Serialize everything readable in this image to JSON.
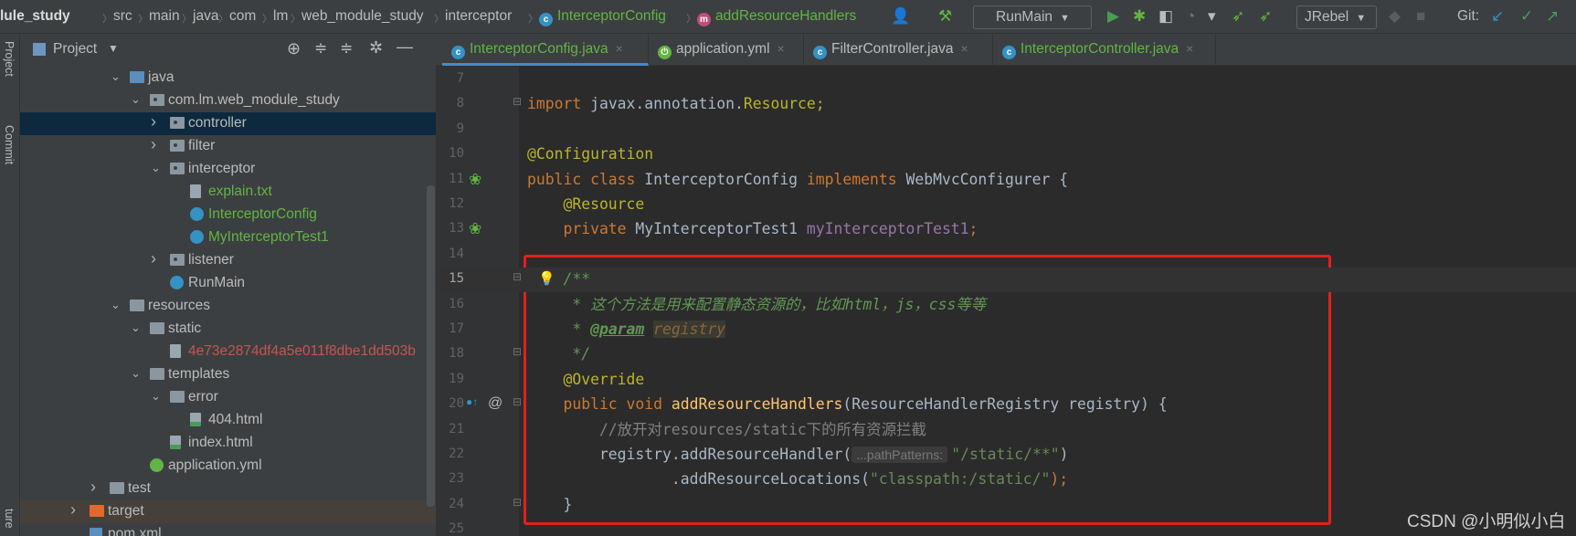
{
  "breadcrumb": [
    "lule_study",
    "src",
    "main",
    "java",
    "com",
    "lm",
    "web_module_study",
    "interceptor",
    "InterceptorConfig",
    "addResourceHandlers"
  ],
  "toolbar": {
    "run_config": "RunMain",
    "jrebel": "JRebel",
    "git_label": "Git:",
    "icons": [
      "user-icon",
      "build-hammer-icon",
      "run-icon",
      "debug-icon",
      "coverage-icon",
      "profile-icon",
      "jrebel-run-icon",
      "jrebel-debug-icon",
      "git-update-icon",
      "git-commit-icon",
      "git-push-icon"
    ]
  },
  "sidestrip": {
    "project": "Project",
    "commit": "Commit",
    "structure": "ture"
  },
  "project_panel": {
    "title": "Project"
  },
  "tree": [
    {
      "label": "java",
      "depth": 0,
      "arrow": "down",
      "icon": "folder-blue"
    },
    {
      "label": "com.lm.web_module_study",
      "depth": 1,
      "arrow": "down",
      "icon": "package"
    },
    {
      "label": "controller",
      "depth": 2,
      "arrow": "right",
      "icon": "package",
      "selected": true
    },
    {
      "label": "filter",
      "depth": 2,
      "arrow": "right",
      "icon": "package"
    },
    {
      "label": "interceptor",
      "depth": 2,
      "arrow": "down",
      "icon": "package"
    },
    {
      "label": "explain.txt",
      "depth": 3,
      "icon": "file",
      "color": "#62b543"
    },
    {
      "label": "InterceptorConfig",
      "depth": 3,
      "icon": "class",
      "color": "#62b543"
    },
    {
      "label": "MyInterceptorTest1",
      "depth": 3,
      "icon": "class",
      "color": "#62b543"
    },
    {
      "label": "listener",
      "depth": 2,
      "arrow": "right",
      "icon": "package"
    },
    {
      "label": "RunMain",
      "depth": 2,
      "icon": "class"
    },
    {
      "label": "resources",
      "depth": 0,
      "arrow": "down",
      "icon": "folder"
    },
    {
      "label": "static",
      "depth": 1,
      "arrow": "down",
      "icon": "folder"
    },
    {
      "label": "4e73e2874df4a5e011f8dbe1dd503b",
      "depth": 2,
      "icon": "file",
      "color": "#c75450"
    },
    {
      "label": "templates",
      "depth": 1,
      "arrow": "down",
      "icon": "folder"
    },
    {
      "label": "error",
      "depth": 2,
      "arrow": "down",
      "icon": "folder"
    },
    {
      "label": "404.html",
      "depth": 3,
      "icon": "html"
    },
    {
      "label": "index.html",
      "depth": 2,
      "icon": "html"
    },
    {
      "label": "application.yml",
      "depth": 1,
      "icon": "spring"
    },
    {
      "label": "test",
      "depth": -1,
      "arrow": "right",
      "icon": "folder"
    },
    {
      "label": "target",
      "depth": -2,
      "arrow": "right",
      "icon": "folder-orange",
      "highlighted": true
    },
    {
      "label": "pom.xml",
      "depth": -2,
      "icon": "maven"
    }
  ],
  "tabs": [
    {
      "label": "InterceptorConfig.java",
      "active": true,
      "color": "#62b543",
      "icon": "class"
    },
    {
      "label": "application.yml",
      "icon": "spring"
    },
    {
      "label": "FilterController.java",
      "icon": "class"
    },
    {
      "label": "InterceptorController.java",
      "color": "#62b543",
      "icon": "class"
    }
  ],
  "editor": {
    "current_line": 15,
    "lines": [
      {
        "n": 7,
        "t": []
      },
      {
        "n": 8,
        "t": [
          [
            "import ",
            "kw"
          ],
          [
            "javax.annotation.",
            "def"
          ],
          [
            "Resource;",
            "warn"
          ]
        ]
      },
      {
        "n": 9,
        "t": []
      },
      {
        "n": 10,
        "t": [
          [
            "@Configuration",
            "ann"
          ]
        ]
      },
      {
        "n": 11,
        "t": [
          [
            "public class ",
            "kw"
          ],
          [
            "InterceptorConfig ",
            "def"
          ],
          [
            "implements ",
            "kw"
          ],
          [
            "WebMvcConfigurer {",
            "def"
          ]
        ]
      },
      {
        "n": 12,
        "t": [
          [
            "    @Resource",
            "ann"
          ]
        ]
      },
      {
        "n": 13,
        "t": [
          [
            "    private ",
            "kw"
          ],
          [
            "MyInterceptorTest1 ",
            "def"
          ],
          [
            "myInterceptorTest1",
            "field"
          ],
          [
            ";",
            "kw"
          ]
        ]
      },
      {
        "n": 14,
        "t": []
      },
      {
        "n": 15,
        "t": [
          [
            "    /**",
            "doc"
          ]
        ]
      },
      {
        "n": 16,
        "t": [
          [
            "     * 这个方法是用来配置静态资源的，比如html，js，css等等",
            "doc"
          ]
        ]
      },
      {
        "n": 17,
        "t": [
          [
            "     * ",
            "doc"
          ],
          [
            "@param",
            "doctag"
          ],
          [
            " ",
            "doc"
          ],
          [
            "registry",
            "docparam"
          ]
        ]
      },
      {
        "n": 18,
        "t": [
          [
            "     */",
            "doc"
          ]
        ]
      },
      {
        "n": 19,
        "t": [
          [
            "    @Override",
            "ann"
          ]
        ]
      },
      {
        "n": 20,
        "t": [
          [
            "    public void ",
            "kw"
          ],
          [
            "addResourceHandlers",
            "method"
          ],
          [
            "(ResourceHandlerRegistry registry) {",
            "def"
          ]
        ]
      },
      {
        "n": 21,
        "t": [
          [
            "        //放开对resources/static下的所有资源拦截",
            "cmt"
          ]
        ]
      },
      {
        "n": 22,
        "t": [
          [
            "        registry.addResourceHandler(",
            "def"
          ],
          [
            "...pathPatterns:",
            "hint"
          ],
          [
            "\"/static/**\"",
            "str"
          ],
          [
            ")",
            "def"
          ]
        ]
      },
      {
        "n": 23,
        "t": [
          [
            "                .addResourceLocations(",
            "def"
          ],
          [
            "\"classpath:/static/\"",
            "str"
          ],
          [
            ");",
            "kw"
          ]
        ]
      },
      {
        "n": 24,
        "t": [
          [
            "    }",
            "def"
          ]
        ]
      },
      {
        "n": 25,
        "t": []
      }
    ]
  },
  "watermark": "CSDN @小明似小白",
  "colors": {
    "highlight_box": "#e3201b",
    "accent": "#4a88c7",
    "background": "#2b2b2b"
  }
}
